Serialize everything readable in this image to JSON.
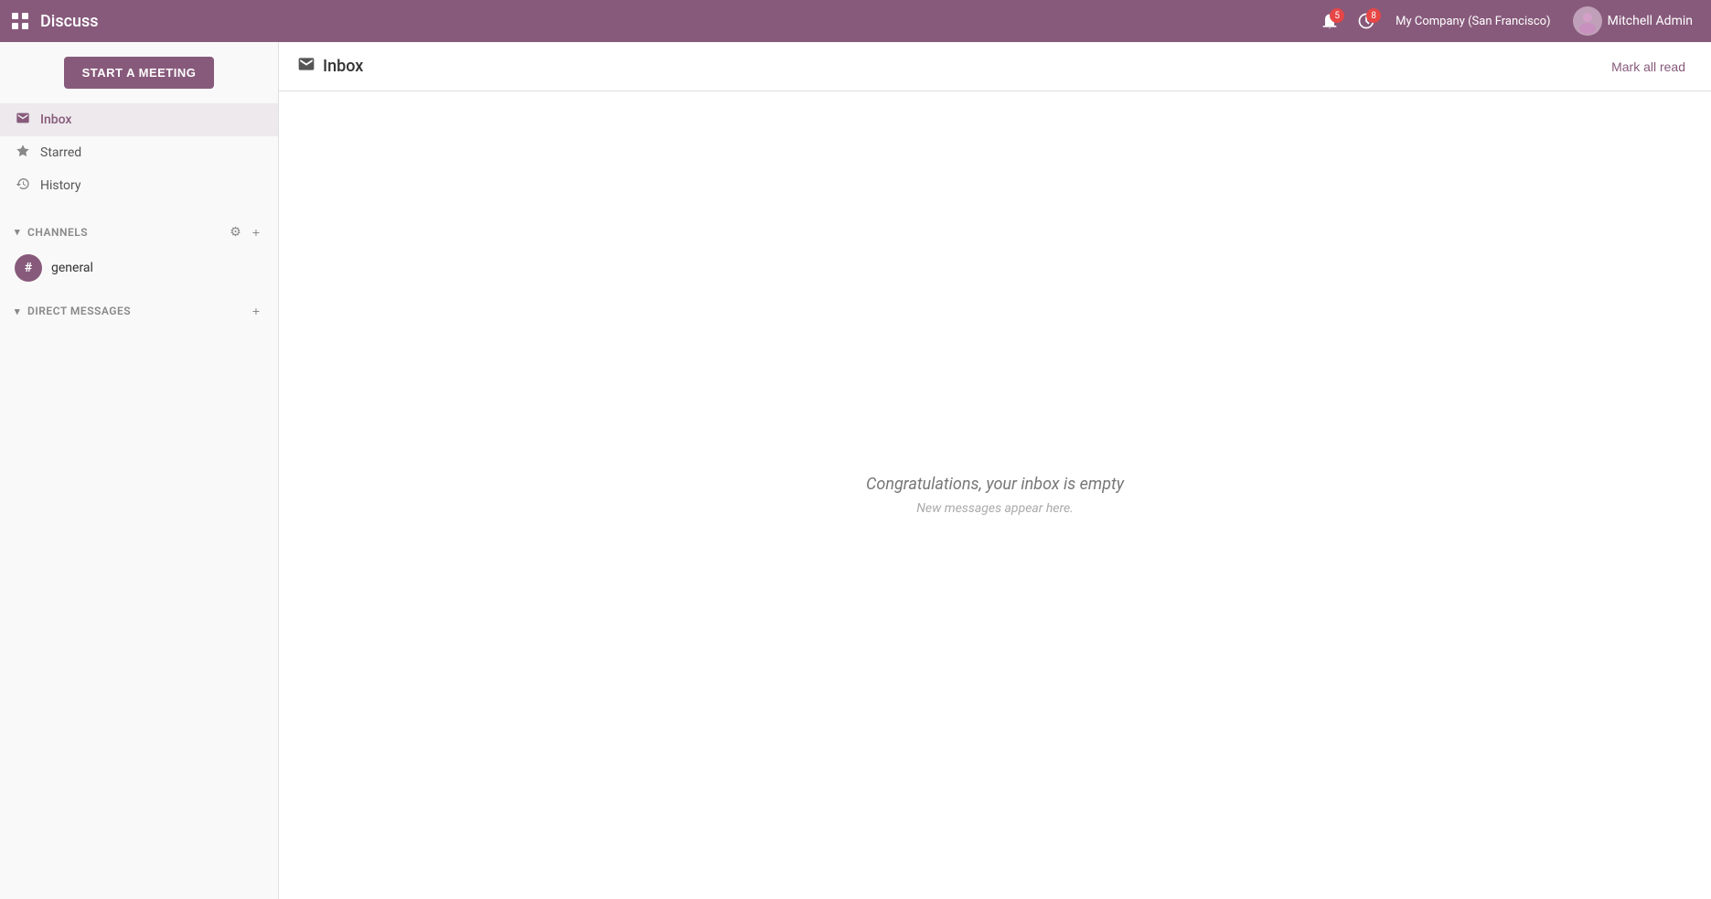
{
  "topbar": {
    "app_name": "Discuss",
    "company": "My Company (San Francisco)",
    "user_name": "Mitchell Admin",
    "notifications_count": "5",
    "clock_count": "8"
  },
  "sidebar": {
    "start_meeting_label": "START A MEETING",
    "nav_items": [
      {
        "id": "inbox",
        "label": "Inbox",
        "icon": "📥",
        "active": true
      },
      {
        "id": "starred",
        "label": "Starred",
        "icon": "⭐",
        "active": false
      },
      {
        "id": "history",
        "label": "History",
        "icon": "🕐",
        "active": false
      }
    ],
    "channels_section": {
      "label": "CHANNELS",
      "gear_label": "⚙",
      "add_label": "+"
    },
    "channels": [
      {
        "id": "general",
        "name": "general",
        "symbol": "#"
      }
    ],
    "direct_messages_section": {
      "label": "DIRECT MESSAGES",
      "add_label": "+"
    }
  },
  "content": {
    "header_icon": "📥",
    "title": "Inbox",
    "mark_all_read_label": "Mark all read",
    "empty_title": "Congratulations, your inbox is empty",
    "empty_subtitle": "New messages appear here."
  }
}
